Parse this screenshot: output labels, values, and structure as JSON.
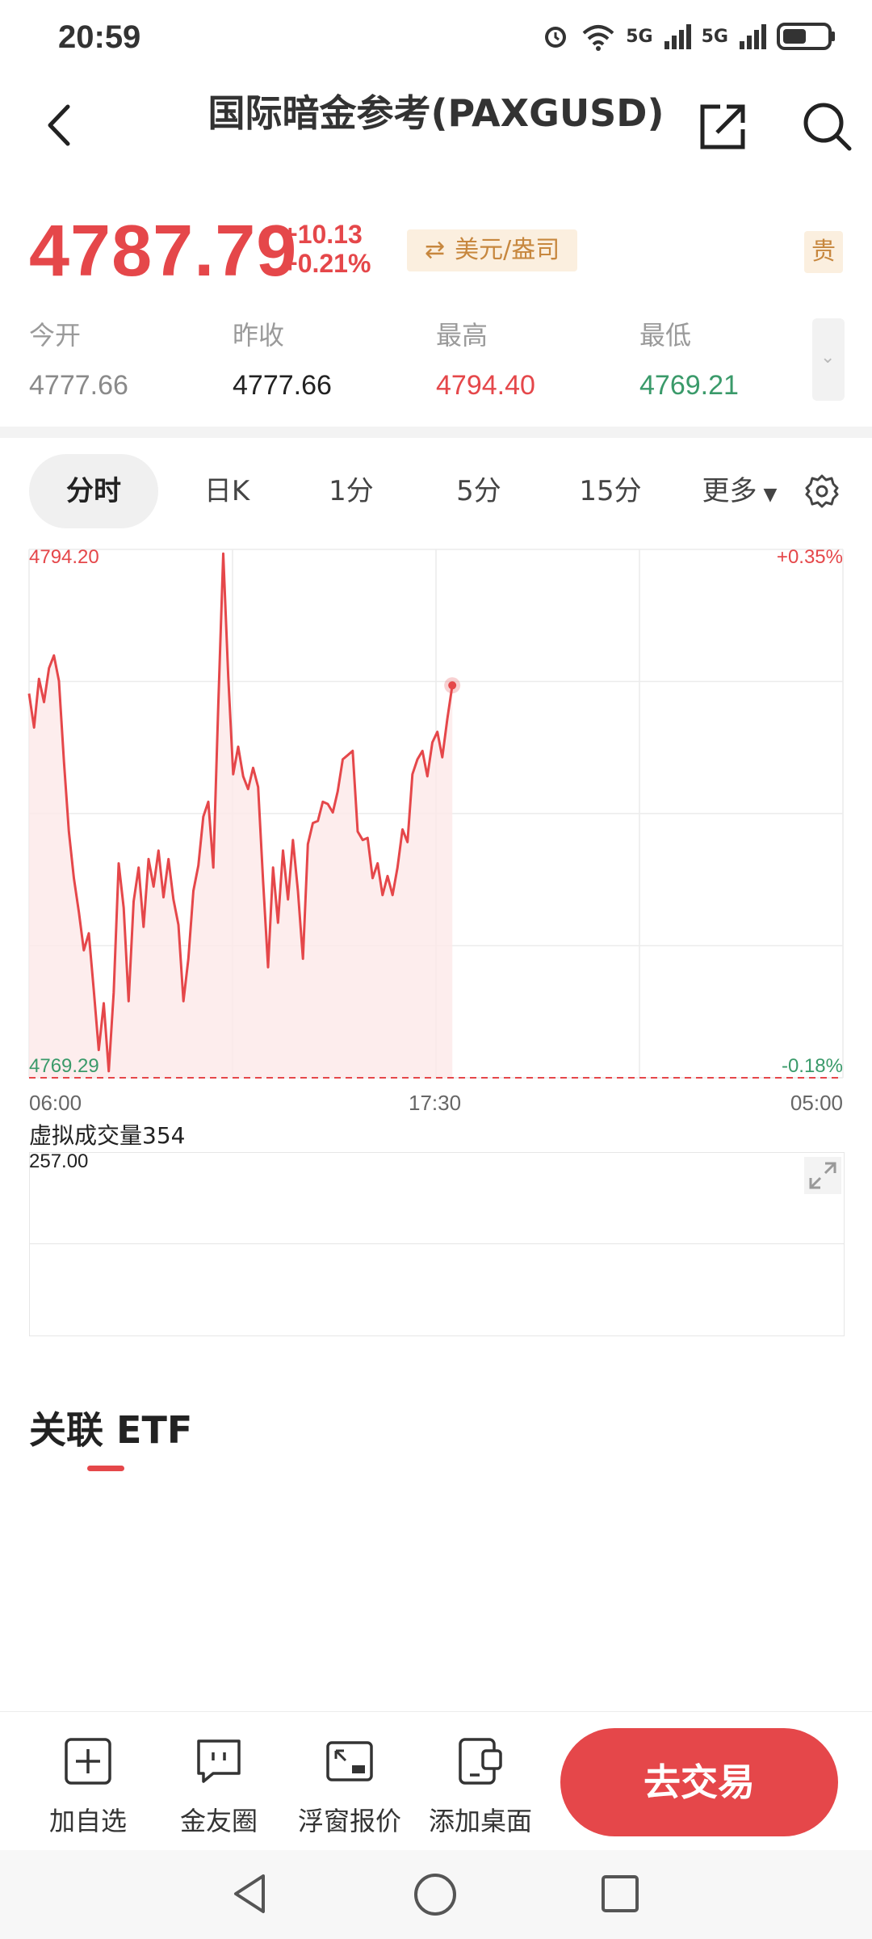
{
  "status": {
    "time": "20:59",
    "signal1": "5G",
    "signal2": "5G"
  },
  "header": {
    "title": "国际暗金参考(PAXGUSD)"
  },
  "quote": {
    "price": "4787.79",
    "change_abs": "+10.13",
    "change_pct": "+0.21%",
    "unit_label": "美元/盎司",
    "tag": "贵"
  },
  "stats": [
    {
      "label": "今开",
      "value": "4777.66",
      "color": "#8a8a8a"
    },
    {
      "label": "昨收",
      "value": "4777.66",
      "color": "#222222"
    },
    {
      "label": "最高",
      "value": "4794.40",
      "color": "#e5474a"
    },
    {
      "label": "最低",
      "value": "4769.21",
      "color": "#3a9a6a"
    }
  ],
  "tabs": {
    "intraday": "分时",
    "daily": "日K",
    "m1": "1分",
    "m5": "5分",
    "m15": "15分",
    "more": "更多"
  },
  "chart_data": {
    "type": "area",
    "ylim": [
      4769.29,
      4794.2
    ],
    "y_top_label": "4794.20",
    "y_bottom_label": "4769.29",
    "pct_top_label": "+0.35%",
    "pct_bottom_label": "-0.18%",
    "x_tick_labels": [
      "06:00",
      "17:30",
      "05:00"
    ],
    "session_fraction_elapsed": 0.52,
    "line_color": "#e5474a",
    "series": [
      {
        "values": [
          4787.4,
          4785.8,
          4788.1,
          4787.0,
          4788.6,
          4789.2,
          4788.0,
          4784.2,
          4780.9,
          4778.7,
          4777.1,
          4775.3,
          4776.1,
          4773.4,
          4770.6,
          4772.8,
          4769.6,
          4773.3,
          4779.4,
          4777.3,
          4772.9,
          4777.6,
          4779.2,
          4776.4,
          4779.6,
          4778.3,
          4780.0,
          4777.8,
          4779.6,
          4777.7,
          4776.5,
          4772.9,
          4774.9,
          4778.1,
          4779.3,
          4781.6,
          4782.3,
          4779.2,
          4786.8,
          4794.0,
          4788.2,
          4783.6,
          4784.9,
          4783.5,
          4782.9,
          4783.9,
          4783.0,
          4778.6,
          4774.5,
          4779.2,
          4776.6,
          4780.0,
          4777.7,
          4780.5,
          4778.1,
          4774.9,
          4780.3,
          4781.3,
          4781.4,
          4782.3,
          4782.2,
          4781.8,
          4782.8,
          4784.3,
          4784.5,
          4784.7,
          4780.9,
          4780.5,
          4780.6,
          4778.7,
          4779.4,
          4777.9,
          4778.8,
          4777.9,
          4779.2,
          4781.0,
          4780.4,
          4783.6,
          4784.3,
          4784.7,
          4783.5,
          4785.1,
          4785.6,
          4784.4,
          4786.2,
          4787.79
        ]
      }
    ]
  },
  "volume": {
    "label": "虚拟成交量354",
    "value": "257.00"
  },
  "etf": {
    "title": "关联 ETF"
  },
  "bottom": {
    "watch": "加自选",
    "circle": "金友圈",
    "float": "浮窗报价",
    "desktop": "添加桌面",
    "trade": "去交易"
  }
}
